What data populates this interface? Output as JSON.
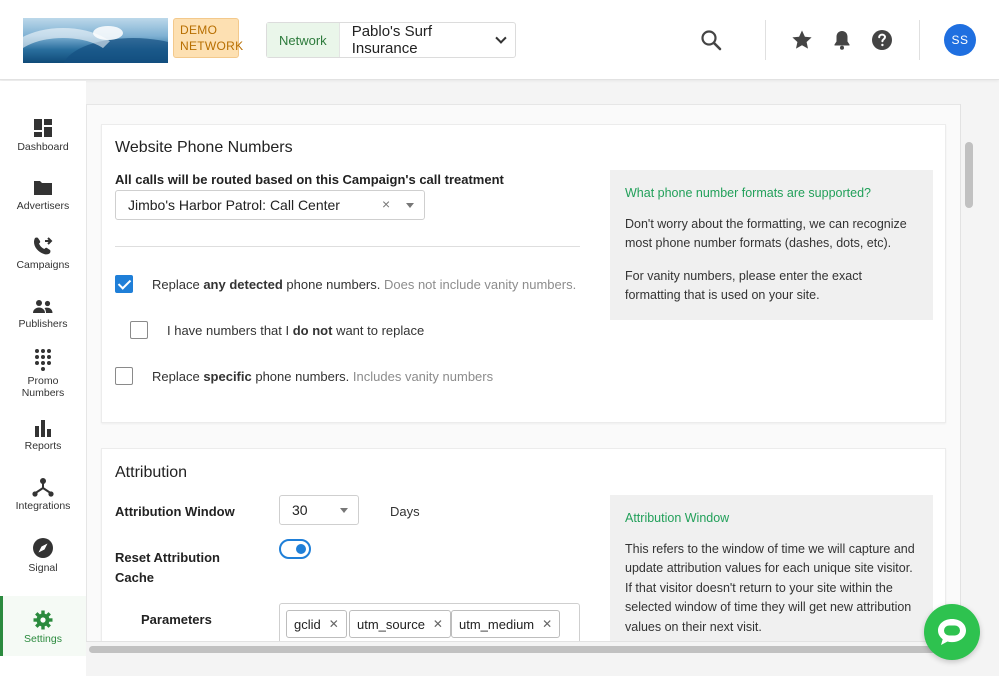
{
  "header": {
    "demo_badge": "DEMO\nNETWORK",
    "demo_line1": "DEMO",
    "demo_line2": "NETWORK",
    "network_label": "Network",
    "network_value": "Pablo's Surf Insurance",
    "avatar_initials": "SS"
  },
  "sidebar": {
    "items": [
      {
        "label": "Dashboard",
        "icon": "dashboard-icon"
      },
      {
        "label": "Advertisers",
        "icon": "folder-icon"
      },
      {
        "label": "Campaigns",
        "icon": "phone-forward-icon"
      },
      {
        "label": "Publishers",
        "icon": "people-icon"
      },
      {
        "label": "Promo\nNumbers",
        "label1": "Promo",
        "label2": "Numbers",
        "icon": "dialpad-icon"
      },
      {
        "label": "Reports",
        "icon": "bar-chart-icon"
      },
      {
        "label": "Integrations",
        "icon": "network-icon"
      },
      {
        "label": "Signal",
        "icon": "compass-icon"
      },
      {
        "label": "Settings",
        "icon": "gear-icon",
        "active": true
      }
    ]
  },
  "website_phone": {
    "title": "Website Phone Numbers",
    "routing_label": "All calls will be routed based on this Campaign's call treatment",
    "routing_value": "Jimbo's Harbor Patrol: Call Center",
    "opt1_pre": "Replace ",
    "opt1_bold": "any detected",
    "opt1_post": " phone numbers. ",
    "opt1_muted": "Does not include vanity numbers.",
    "opt2_pre": "I have numbers that I ",
    "opt2_bold": "do not",
    "opt2_post": " want to replace",
    "opt3_pre": "Replace ",
    "opt3_bold": "specific",
    "opt3_post": " phone numbers. ",
    "opt3_muted": "Includes vanity numbers",
    "info_title": "What phone number formats are supported?",
    "info_p1": "Don't worry about the formatting, we can recognize most phone number formats (dashes, dots, etc).",
    "info_p2": "For vanity numbers, please enter the exact formatting that is used on your site."
  },
  "attribution": {
    "title": "Attribution",
    "window_label": "Attribution Window",
    "window_value": "30",
    "window_unit": "Days",
    "reset_label": "Reset Attribution Cache",
    "reset_enabled": true,
    "params_label": "Parameters",
    "params": [
      "gclid",
      "utm_source",
      "utm_medium"
    ],
    "info_title": "Attribution Window",
    "info_p1": "This refers to the window of time we will capture and update attribution values for each unique site visitor. If that visitor doesn't return to your site within the selected window of time they will get new attribution values on their next visit."
  },
  "colors": {
    "accent_green": "#2b8a3e",
    "primary_blue": "#1f7fd8",
    "info_green": "#22a05a",
    "chat_green": "#2ec24f"
  }
}
